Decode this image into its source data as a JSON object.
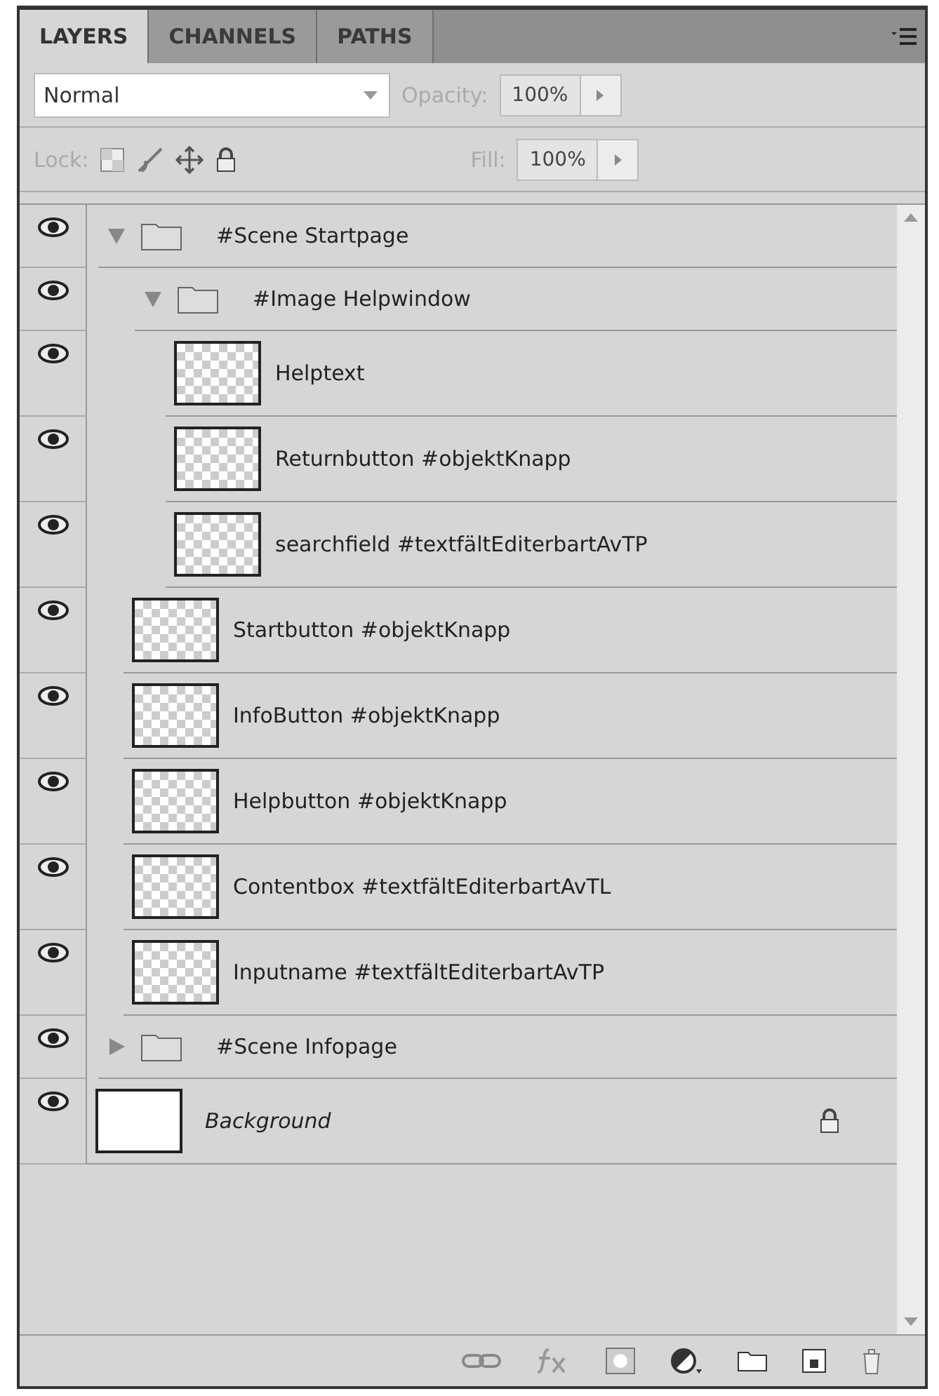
{
  "tabs": [
    {
      "label": "LAYERS",
      "selected": true
    },
    {
      "label": "CHANNELS",
      "selected": false
    },
    {
      "label": "PATHS",
      "selected": false
    }
  ],
  "blend_mode": {
    "value": "Normal"
  },
  "opacity": {
    "label": "Opacity:",
    "value": "100%"
  },
  "lock": {
    "label": "Lock:"
  },
  "fill": {
    "label": "Fill:",
    "value": "100%"
  },
  "layers": [
    {
      "kind": "group",
      "name": "#Scene Startpage",
      "visible": true,
      "expanded": true,
      "children": [
        {
          "kind": "group",
          "name": "#Image Helpwindow",
          "visible": true,
          "expanded": true,
          "children": [
            {
              "kind": "layer",
              "name": "Helptext",
              "visible": true
            },
            {
              "kind": "layer",
              "name": "Returnbutton #objektKnapp",
              "visible": true
            },
            {
              "kind": "layer",
              "name": "searchfield #textfältEditerbartAvTP",
              "visible": true
            }
          ]
        },
        {
          "kind": "layer",
          "name": "Startbutton #objektKnapp",
          "visible": true
        },
        {
          "kind": "layer",
          "name": "InfoButton #objektKnapp",
          "visible": true
        },
        {
          "kind": "layer",
          "name": "Helpbutton #objektKnapp",
          "visible": true
        },
        {
          "kind": "layer",
          "name": "Contentbox #textfältEditerbartAvTL",
          "visible": true
        },
        {
          "kind": "layer",
          "name": "Inputname #textfältEditerbartAvTP",
          "visible": true
        }
      ]
    },
    {
      "kind": "group",
      "name": "#Scene Infopage",
      "visible": true,
      "expanded": false
    },
    {
      "kind": "background",
      "name": "Background",
      "visible": true,
      "locked": true
    }
  ]
}
